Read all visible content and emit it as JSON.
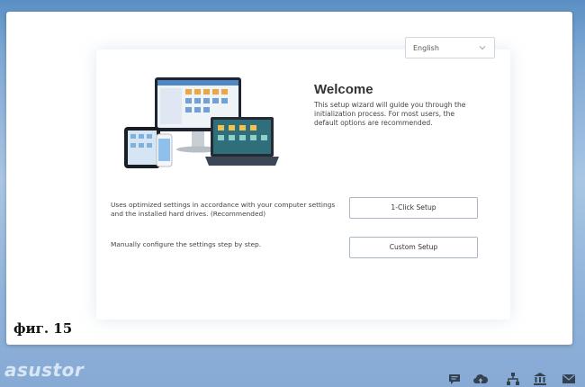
{
  "language": {
    "selected": "English"
  },
  "welcome": {
    "title": "Welcome",
    "description": "This setup wizard will guide you through the initialization process. For most users, the default options are recommended."
  },
  "options": [
    {
      "description": "Uses optimized settings in accordance with your computer settings and the installed hard drives. (Recommended)",
      "button": "1-Click Setup"
    },
    {
      "description": "Manually configure the settings step by step.",
      "button": "Custom Setup"
    }
  ],
  "caption": "фиг. 15",
  "footer": {
    "brand": "asustor",
    "icons": [
      "chat-icon",
      "cloud-icon",
      "network-icon",
      "museum-icon",
      "mail-icon"
    ]
  },
  "colors": {
    "background": "#86aad4",
    "panel": "#ffffff",
    "button_border": "#aab6c4"
  }
}
